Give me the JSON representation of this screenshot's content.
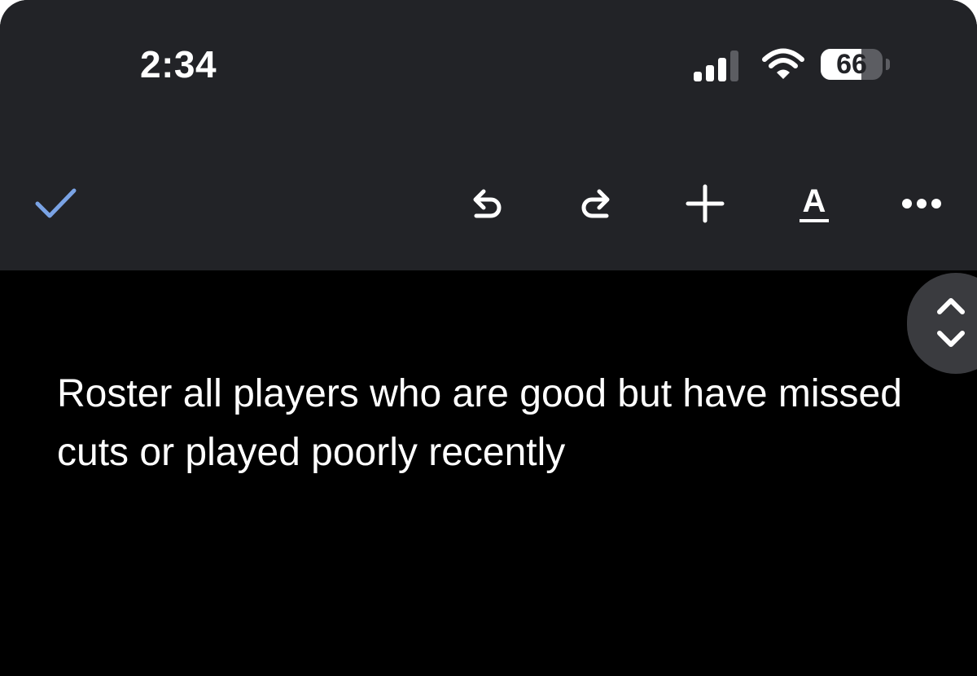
{
  "status_bar": {
    "time": "2:34",
    "battery_level": "66",
    "battery_fraction": 0.66,
    "signal_bars_active": 3,
    "signal_bars_total": 4,
    "icons": [
      "signal-bars-icon",
      "wifi-icon",
      "battery-icon"
    ]
  },
  "toolbar": {
    "buttons": [
      {
        "name": "done",
        "icon": "checkmark-icon"
      },
      {
        "name": "undo",
        "icon": "undo-icon"
      },
      {
        "name": "redo",
        "icon": "redo-icon"
      },
      {
        "name": "insert",
        "icon": "plus-icon"
      },
      {
        "name": "format",
        "icon": "text-format-icon",
        "label": "A"
      },
      {
        "name": "more",
        "icon": "more-dots-icon"
      }
    ],
    "check_color": "#7aa3e5"
  },
  "document": {
    "text": "Roster all players who are good but have missed cuts or played poorly recently"
  },
  "colors": {
    "toolbar_background": "#222327",
    "document_background": "#000000",
    "text": "#ffffff"
  }
}
